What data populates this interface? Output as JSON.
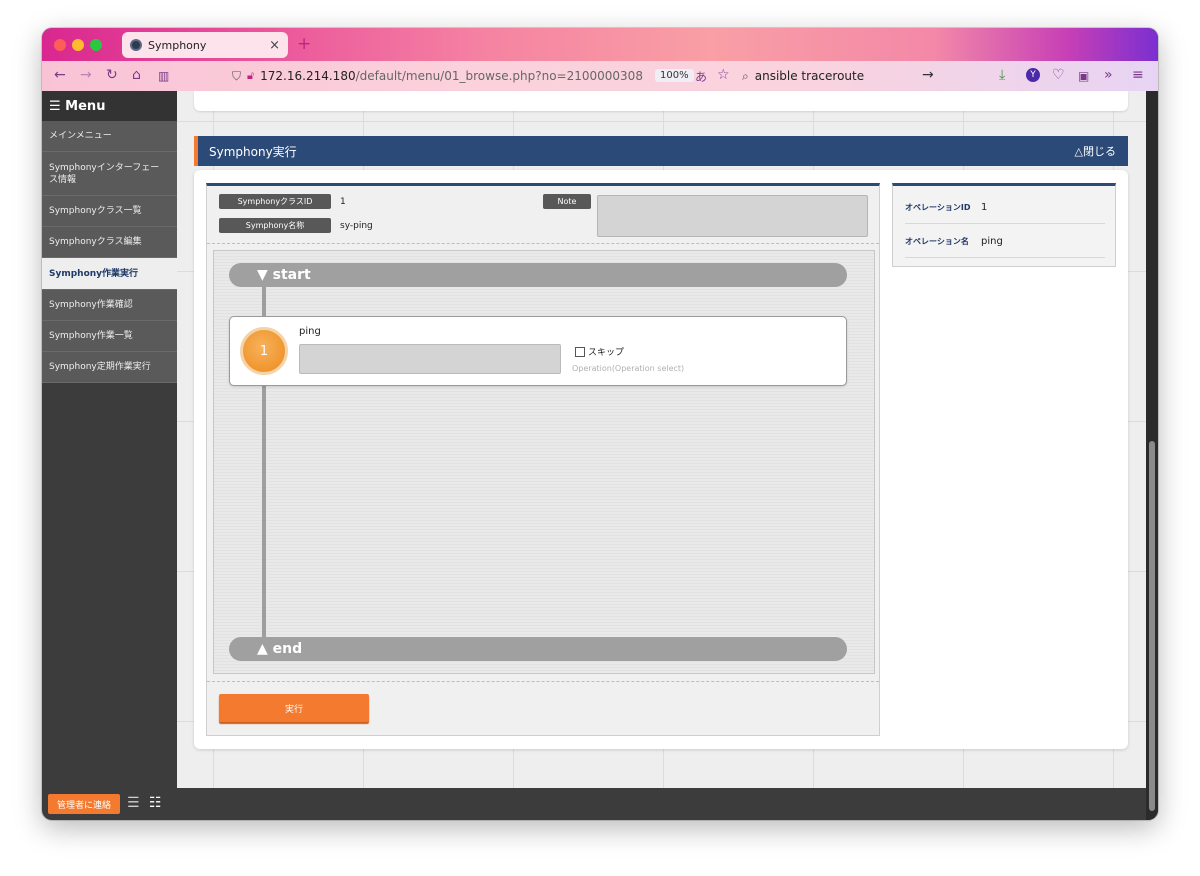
{
  "browser": {
    "tab_title": "Symphony",
    "tab_close": "×",
    "new_tab": "+",
    "url_host": "172.16.214.180",
    "url_path": "/default/menu/01_browse.php?no=2100000308",
    "zoom": "100%",
    "search_text": "ansible traceroute",
    "traffic_colors": [
      "#fd5e57",
      "#febb2e",
      "#2ac840"
    ],
    "accent_color": "#c0247f"
  },
  "sidebar": {
    "header": "☰ Menu",
    "items": [
      {
        "label": "メインメニュー",
        "active": false
      },
      {
        "label": "Symphonyインターフェース情報",
        "active": false
      },
      {
        "label": "Symphonyクラス一覧",
        "active": false
      },
      {
        "label": "Symphonyクラス編集",
        "active": false
      },
      {
        "label": "Symphony作業実行",
        "active": true
      },
      {
        "label": "Symphony作業確認",
        "active": false
      },
      {
        "label": "Symphony作業一覧",
        "active": false
      },
      {
        "label": "Symphony定期作業実行",
        "active": false
      }
    ]
  },
  "section": {
    "title": "Symphony実行",
    "close_label": "△閉じる",
    "header_color": "#2b4a78",
    "accent_color": "#f37a2e"
  },
  "symphony": {
    "class_id_label": "SymphonyクラスID",
    "class_id": "1",
    "name_label": "Symphony名称",
    "name": "sy-ping",
    "note_label": "Note",
    "note": ""
  },
  "flow": {
    "start_label": "▼ start",
    "end_label": "▲ end",
    "movements": [
      {
        "order": "1",
        "name": "ping",
        "operation_value": "",
        "skip_label": "スキップ",
        "skip_checked": false,
        "operation_hint": "Operation(Operation select)"
      }
    ]
  },
  "run_button": "実行",
  "operation": {
    "id_label": "オペレーションID",
    "id": "1",
    "name_label": "オペレーション名",
    "name": "ping"
  },
  "footer": {
    "contact_button": "管理者に連絡"
  }
}
